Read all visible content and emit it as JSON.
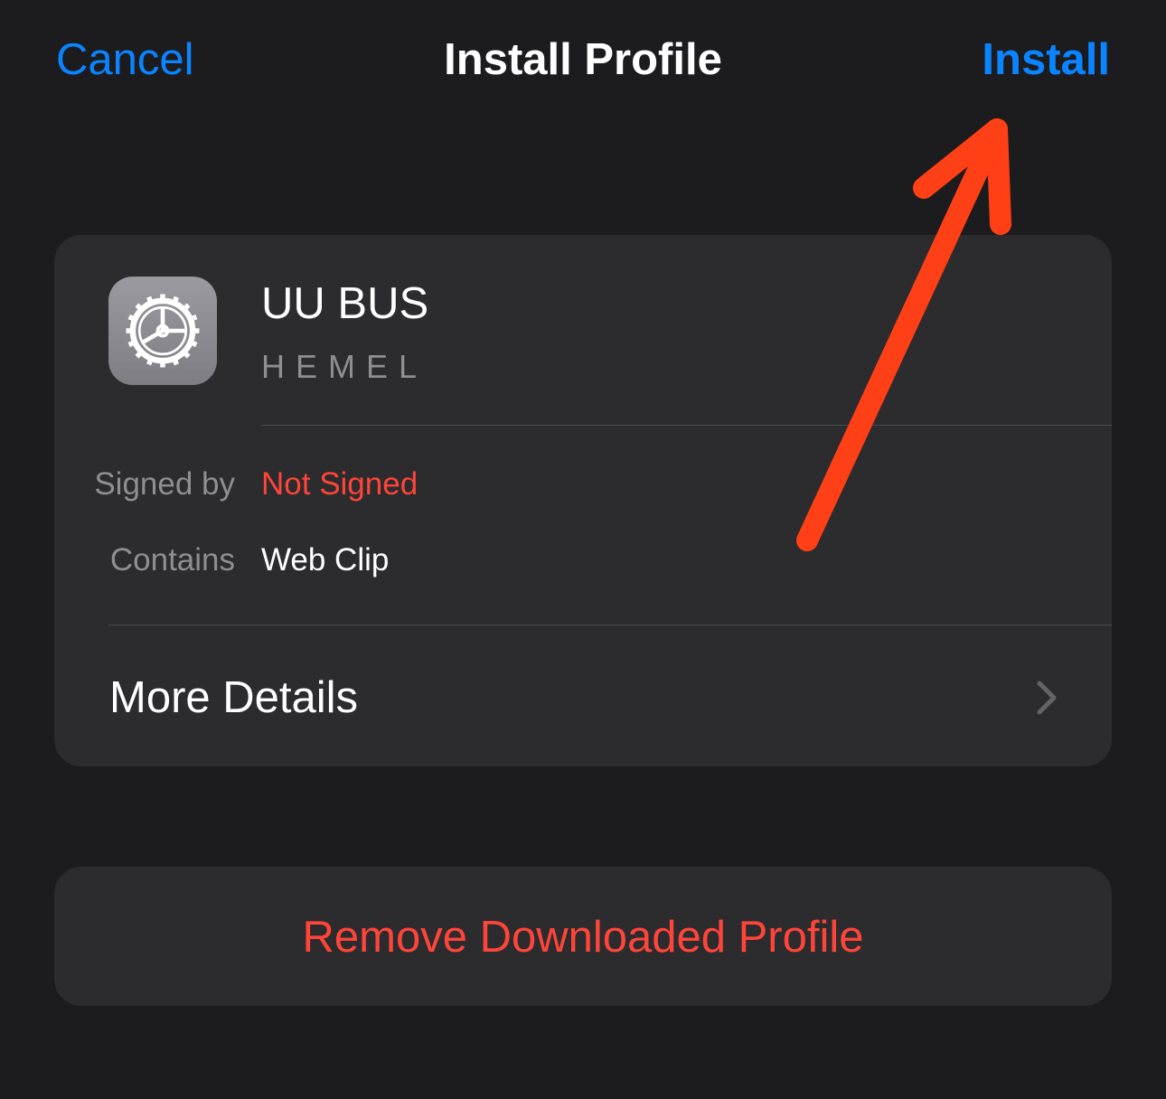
{
  "nav": {
    "cancel_label": "Cancel",
    "title": "Install Profile",
    "install_label": "Install"
  },
  "profile": {
    "icon": "gear-icon",
    "name": "UU BUS",
    "organization": "HEMEL",
    "rows": [
      {
        "label": "Signed by",
        "value": "Not Signed",
        "value_color": "#ff453a"
      },
      {
        "label": "Contains",
        "value": "Web Clip",
        "value_color": "#ffffff"
      }
    ],
    "more_details_label": "More Details"
  },
  "actions": {
    "remove_label": "Remove Downloaded Profile"
  },
  "annotation": {
    "arrow_color": "#ff4016",
    "points_to": "Install"
  },
  "colors": {
    "background": "#1c1c1e",
    "card": "#2c2c2e",
    "accent_blue": "#0a84ff",
    "destructive_red": "#ff453a"
  }
}
